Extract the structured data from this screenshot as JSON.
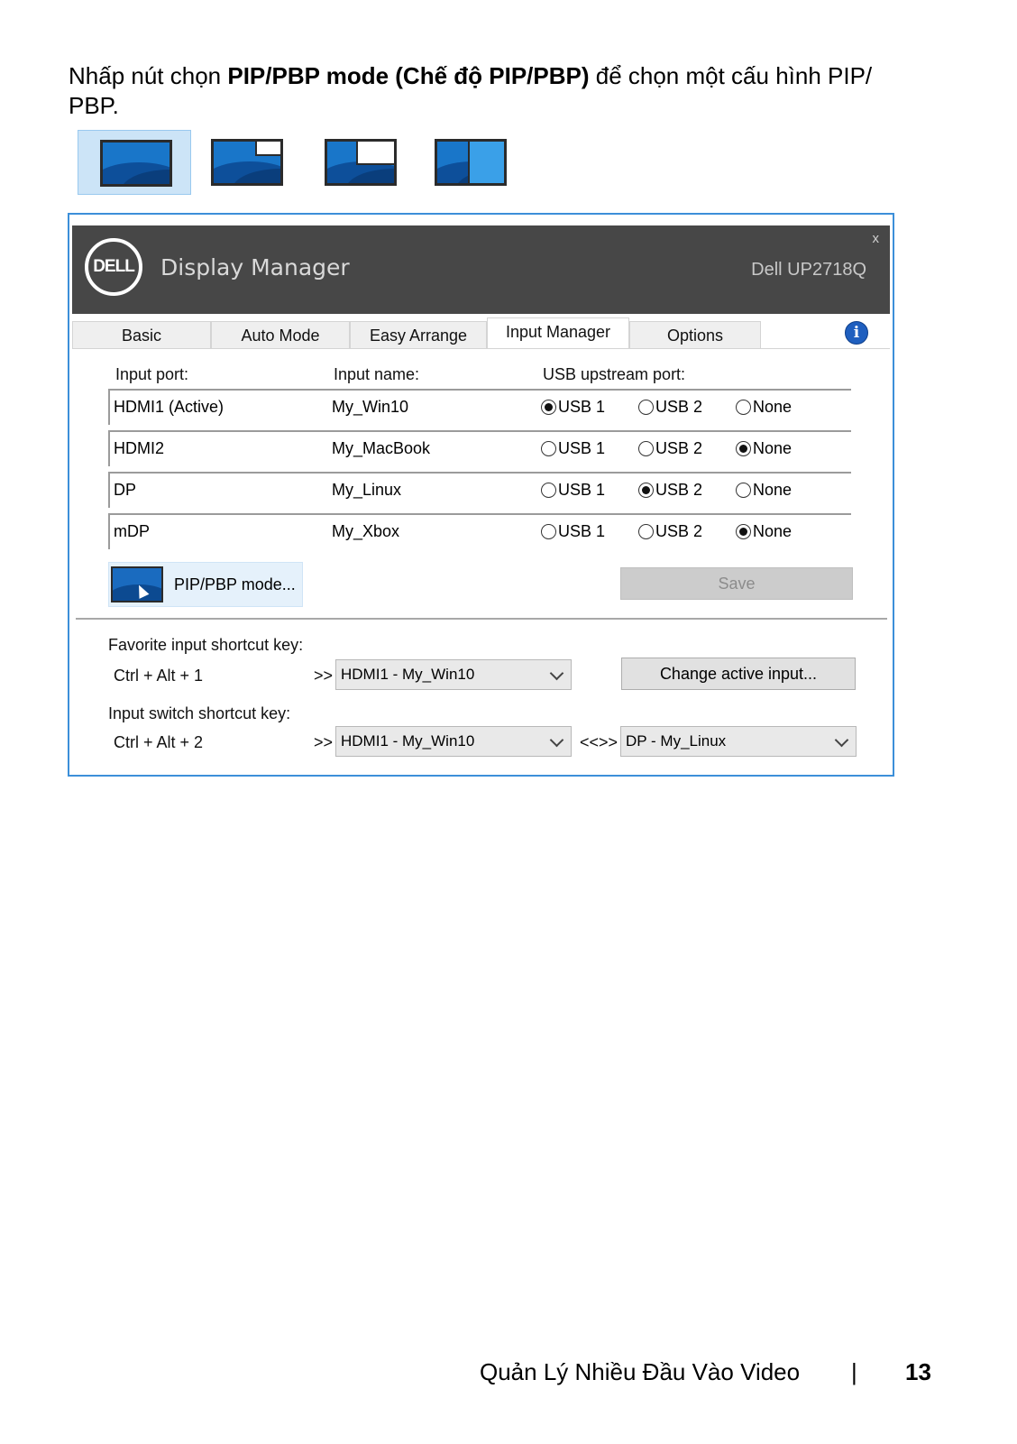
{
  "intro": {
    "pre": "Nhấp nút chọn ",
    "bold": "PIP/PBP mode (Chế độ PIP/PBP)",
    "post": " để chọn một cấu hình PIP/ PBP."
  },
  "thumbnails": [
    {
      "icon": "monitor-single-icon",
      "selected": true
    },
    {
      "icon": "monitor-pip-small-icon",
      "selected": false
    },
    {
      "icon": "monitor-pip-large-icon",
      "selected": false
    },
    {
      "icon": "monitor-pbp-icon",
      "selected": false
    }
  ],
  "app": {
    "logo_text": "DELL",
    "title": "Display Manager",
    "model": "Dell UP2718Q",
    "close": "x",
    "tabs": [
      "Basic",
      "Auto Mode",
      "Easy Arrange",
      "Input Manager",
      "Options"
    ],
    "active_tab": "Input Manager",
    "info_glyph": "i",
    "headers": {
      "port": "Input port:",
      "name": "Input name:",
      "usb": "USB upstream port:"
    },
    "radio_labels": [
      "USB 1",
      "USB 2",
      "None"
    ],
    "rows": [
      {
        "port": "HDMI1 (Active)",
        "name": "My_Win10",
        "selected": "USB 1"
      },
      {
        "port": "HDMI2",
        "name": "My_MacBook",
        "selected": "None"
      },
      {
        "port": "DP",
        "name": "My_Linux",
        "selected": "USB 2"
      },
      {
        "port": "mDP",
        "name": "My_Xbox",
        "selected": "None"
      }
    ],
    "pip_button": "PIP/PBP mode...",
    "save_button": "Save",
    "favorite_label": "Favorite input shortcut key:",
    "favorite_keys": "Ctrl + Alt + 1",
    "arrow": ">>",
    "favorite_value": "HDMI1 - My_Win10",
    "change_button": "Change active input...",
    "switch_label": "Input switch shortcut key:",
    "switch_keys": "Ctrl + Alt + 2",
    "switch_value_a": "HDMI1 - My_Win10",
    "swap_arrow": "<<>>",
    "switch_value_b": "DP - My_Linux"
  },
  "footer": {
    "section": "Quản Lý Nhiều Đầu Vào Video",
    "separator": "|",
    "page": "13"
  }
}
